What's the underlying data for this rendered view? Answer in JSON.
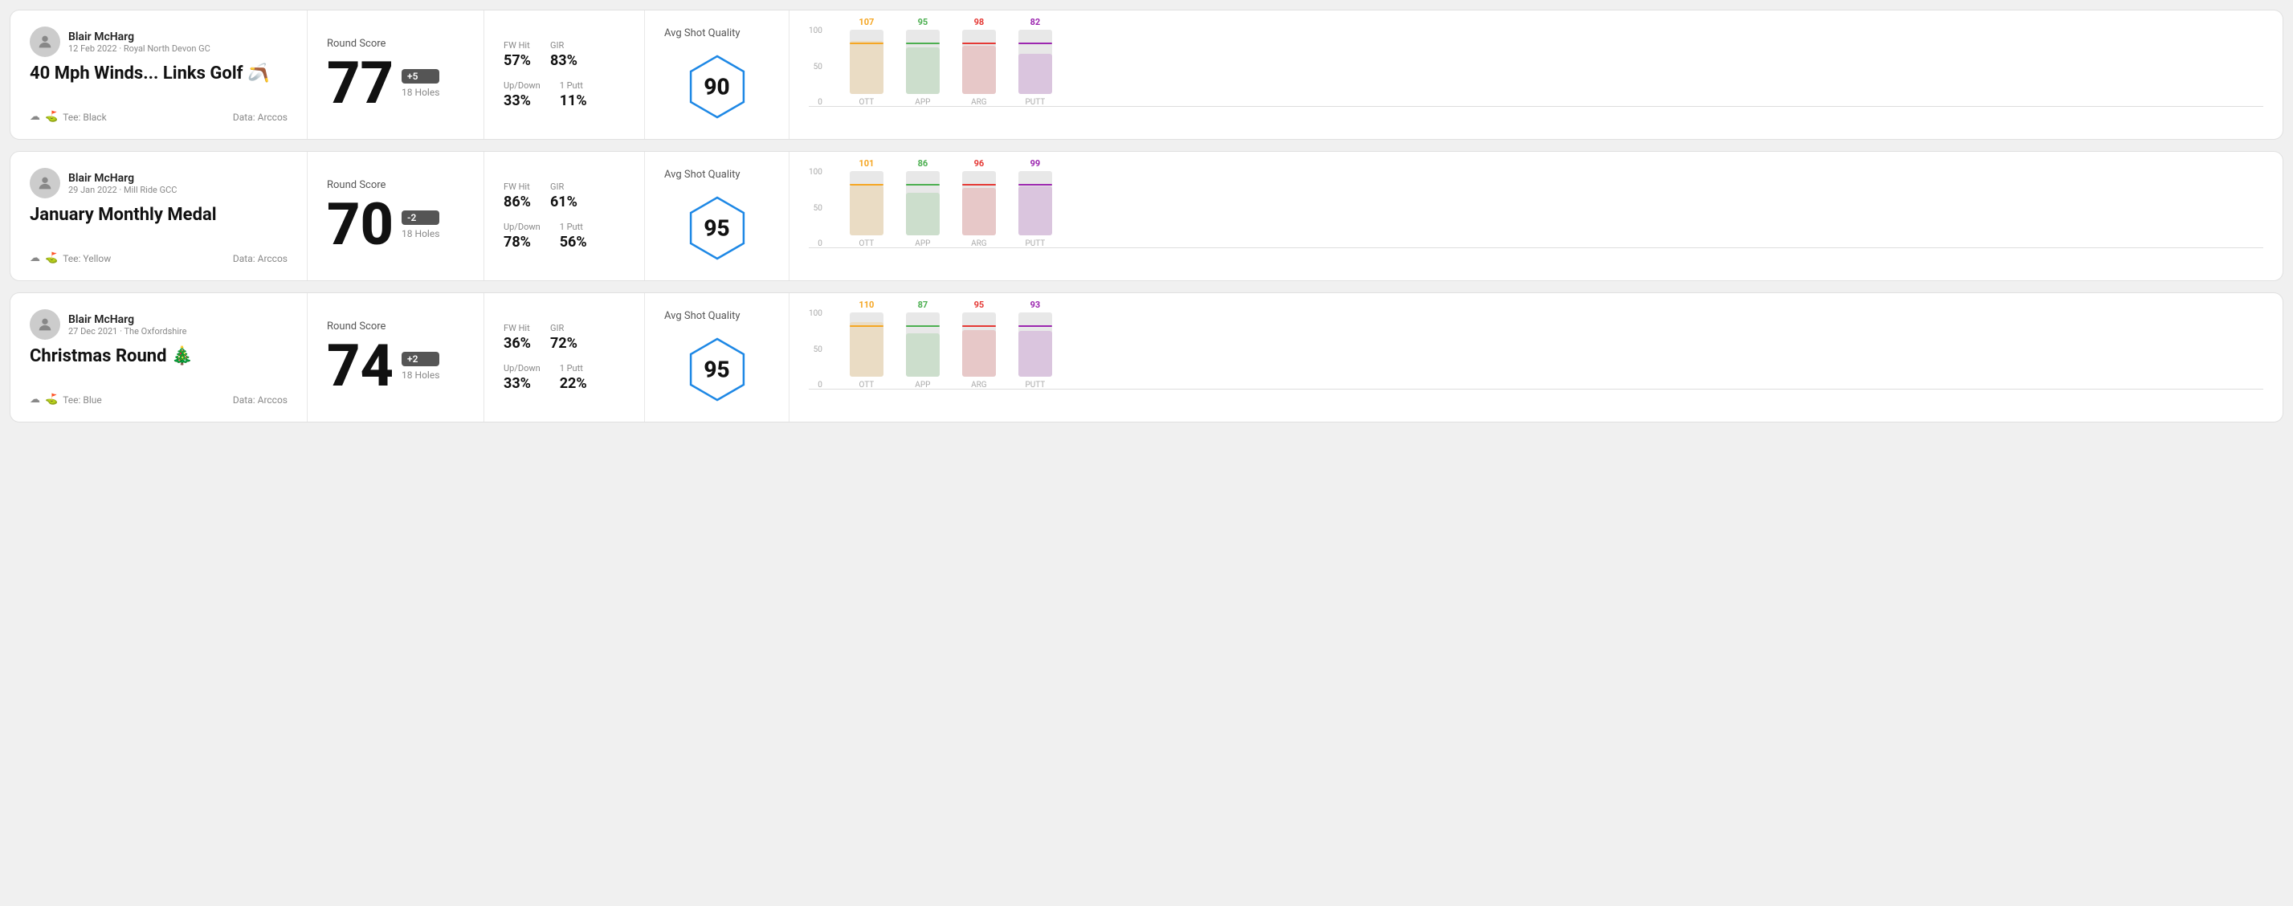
{
  "rounds": [
    {
      "id": "round1",
      "user": {
        "name": "Blair McHarg",
        "meta": "12 Feb 2022 · Royal North Devon GC"
      },
      "title": "40 Mph Winds... Links Golf 🪃",
      "tee": "Black",
      "data_source": "Data: Arccos",
      "score": {
        "label": "Round Score",
        "number": "77",
        "badge": "+5",
        "holes": "18 Holes"
      },
      "stats": {
        "fw_hit_label": "FW Hit",
        "fw_hit_value": "57%",
        "gir_label": "GIR",
        "gir_value": "83%",
        "updown_label": "Up/Down",
        "updown_value": "33%",
        "putt1_label": "1 Putt",
        "putt1_value": "11%"
      },
      "quality": {
        "label": "Avg Shot Quality",
        "score": "90"
      },
      "chart": {
        "bars": [
          {
            "label": "OTT",
            "value": 107,
            "color": "#f5a623",
            "max": 130
          },
          {
            "label": "APP",
            "value": 95,
            "color": "#4caf50",
            "max": 130
          },
          {
            "label": "ARG",
            "value": 98,
            "color": "#e53935",
            "max": 130
          },
          {
            "label": "PUTT",
            "value": 82,
            "color": "#9c27b0",
            "max": 130
          }
        ],
        "y_labels": [
          "100",
          "50",
          "0"
        ]
      }
    },
    {
      "id": "round2",
      "user": {
        "name": "Blair McHarg",
        "meta": "29 Jan 2022 · Mill Ride GCC"
      },
      "title": "January Monthly Medal",
      "tee": "Yellow",
      "data_source": "Data: Arccos",
      "score": {
        "label": "Round Score",
        "number": "70",
        "badge": "-2",
        "holes": "18 Holes"
      },
      "stats": {
        "fw_hit_label": "FW Hit",
        "fw_hit_value": "86%",
        "gir_label": "GIR",
        "gir_value": "61%",
        "updown_label": "Up/Down",
        "updown_value": "78%",
        "putt1_label": "1 Putt",
        "putt1_value": "56%"
      },
      "quality": {
        "label": "Avg Shot Quality",
        "score": "95"
      },
      "chart": {
        "bars": [
          {
            "label": "OTT",
            "value": 101,
            "color": "#f5a623",
            "max": 130
          },
          {
            "label": "APP",
            "value": 86,
            "color": "#4caf50",
            "max": 130
          },
          {
            "label": "ARG",
            "value": 96,
            "color": "#e53935",
            "max": 130
          },
          {
            "label": "PUTT",
            "value": 99,
            "color": "#9c27b0",
            "max": 130
          }
        ],
        "y_labels": [
          "100",
          "50",
          "0"
        ]
      }
    },
    {
      "id": "round3",
      "user": {
        "name": "Blair McHarg",
        "meta": "27 Dec 2021 · The Oxfordshire"
      },
      "title": "Christmas Round 🎄",
      "tee": "Blue",
      "data_source": "Data: Arccos",
      "score": {
        "label": "Round Score",
        "number": "74",
        "badge": "+2",
        "holes": "18 Holes"
      },
      "stats": {
        "fw_hit_label": "FW Hit",
        "fw_hit_value": "36%",
        "gir_label": "GIR",
        "gir_value": "72%",
        "updown_label": "Up/Down",
        "updown_value": "33%",
        "putt1_label": "1 Putt",
        "putt1_value": "22%"
      },
      "quality": {
        "label": "Avg Shot Quality",
        "score": "95"
      },
      "chart": {
        "bars": [
          {
            "label": "OTT",
            "value": 110,
            "color": "#f5a623",
            "max": 130
          },
          {
            "label": "APP",
            "value": 87,
            "color": "#4caf50",
            "max": 130
          },
          {
            "label": "ARG",
            "value": 95,
            "color": "#e53935",
            "max": 130
          },
          {
            "label": "PUTT",
            "value": 93,
            "color": "#9c27b0",
            "max": 130
          }
        ],
        "y_labels": [
          "100",
          "50",
          "0"
        ]
      }
    }
  ]
}
